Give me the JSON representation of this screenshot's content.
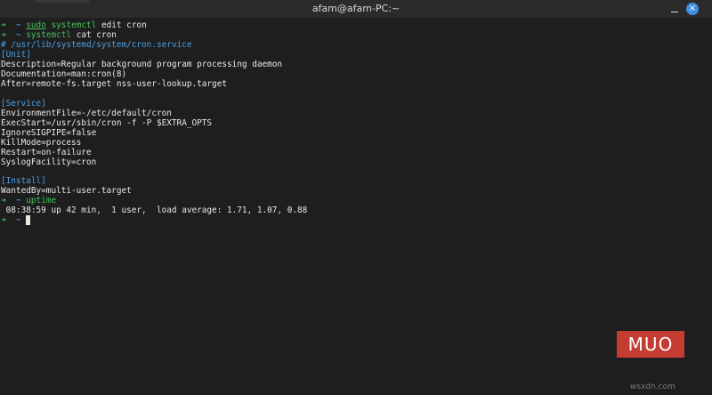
{
  "window": {
    "title": "afam@afam-PC:~",
    "close_glyph": "×"
  },
  "prompt": {
    "arrow": "➜",
    "dir": "~"
  },
  "commands": {
    "edit": {
      "sudo": "sudo",
      "cmd": "systemctl",
      "args": " edit cron"
    },
    "cat": {
      "cmd": "systemctl",
      "args": " cat cron"
    },
    "uptime": {
      "cmd": "uptime"
    }
  },
  "output": {
    "path": "# /usr/lib/systemd/system/cron.service",
    "unit_header": "[Unit]",
    "unit_lines": [
      "Description=Regular background program processing daemon",
      "Documentation=man:cron(8)",
      "After=remote-fs.target nss-user-lookup.target"
    ],
    "service_header": "[Service]",
    "service_lines": [
      "EnvironmentFile=-/etc/default/cron",
      "ExecStart=/usr/sbin/cron -f -P $EXTRA_OPTS",
      "IgnoreSIGPIPE=false",
      "KillMode=process",
      "Restart=on-failure",
      "SyslogFacility=cron"
    ],
    "install_header": "[Install]",
    "install_lines": [
      "WantedBy=multi-user.target"
    ],
    "uptime_result": " 08:38:59 up 42 min,  1 user,  load average: 1.71, 1.07, 0.88"
  },
  "logo": {
    "text": "MUO"
  },
  "watermark": {
    "text": "wsxdn.com"
  },
  "colors": {
    "background": "#1e1e1e",
    "prompt_green": "#3fc25a",
    "prompt_blue": "#5aa8f0",
    "section_blue": "#4aa2e8",
    "logo_red": "#c43c32"
  }
}
